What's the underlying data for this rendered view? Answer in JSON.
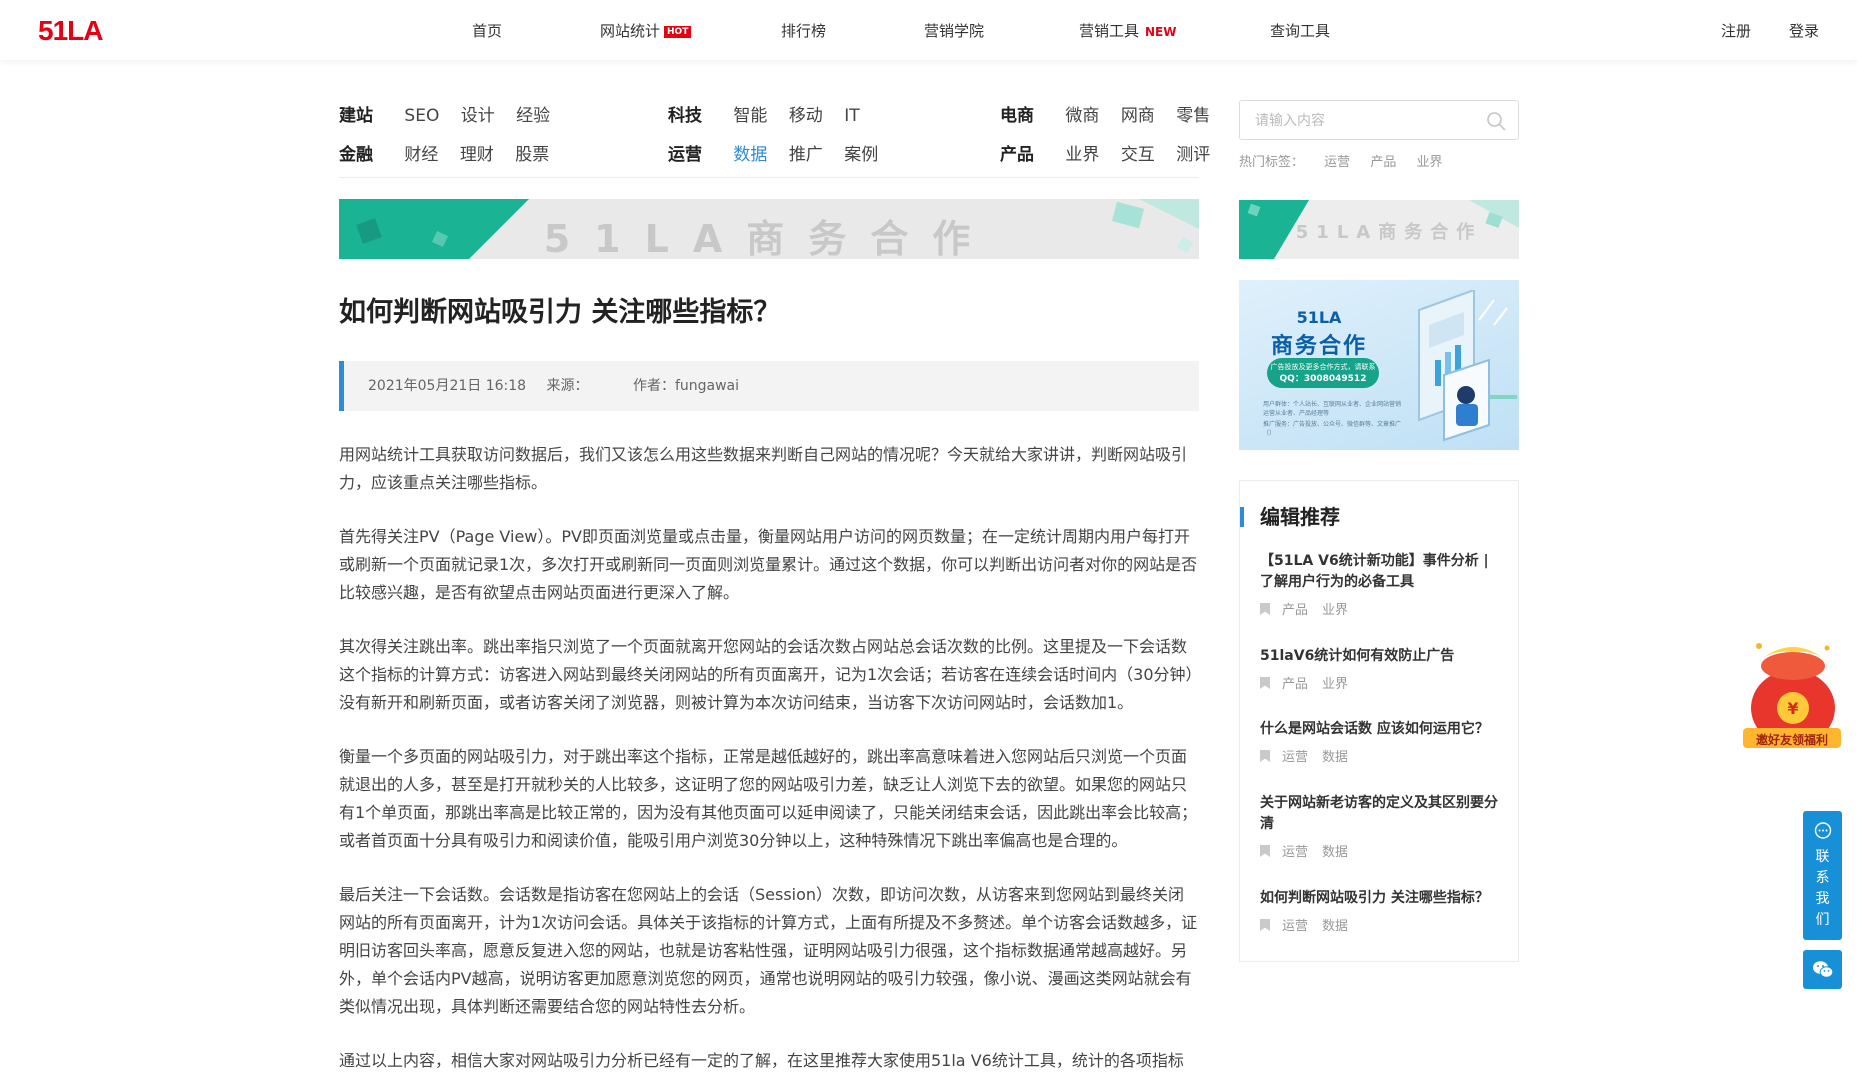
{
  "header": {
    "logo_text": "51LA",
    "nav": [
      {
        "label": "首页"
      },
      {
        "label": "网站统计",
        "badge": "HOT"
      },
      {
        "label": "排行榜"
      },
      {
        "label": "营销学院"
      },
      {
        "label": "营销工具",
        "badge": "NEW"
      },
      {
        "label": "查询工具"
      }
    ],
    "register": "注册",
    "login": "登录"
  },
  "categories": {
    "groups": [
      {
        "head": "建站",
        "items": [
          "SEO",
          "设计",
          "经验"
        ]
      },
      {
        "head": "科技",
        "items": [
          "智能",
          "移动",
          "IT"
        ]
      },
      {
        "head": "电商",
        "items": [
          "微商",
          "网商",
          "零售"
        ]
      },
      {
        "head": "金融",
        "items": [
          "财经",
          "理财",
          "股票"
        ]
      },
      {
        "head": "运营",
        "items": [
          "数据",
          "推广",
          "案例"
        ],
        "active": "数据"
      },
      {
        "head": "产品",
        "items": [
          "业界",
          "交互",
          "测评"
        ]
      }
    ]
  },
  "banner": {
    "main_text": "51LA商务合作",
    "side_text": "51LA商务合作"
  },
  "search": {
    "placeholder": "请输入内容",
    "hot_label": "热门标签：",
    "hot_tags": [
      "运营",
      "产品",
      "业界"
    ]
  },
  "article": {
    "title": "如何判断网站吸引力 关注哪些指标？",
    "date": "2021年05月21日 16:18",
    "source": "来源：",
    "author": "作者：fungawai",
    "paragraphs": [
      "用网站统计工具获取访问数据后，我们又该怎么用这些数据来判断自己网站的情况呢？今天就给大家讲讲，判断网站吸引力，应该重点关注哪些指标。",
      "首先得关注PV（Page View）。PV即页面浏览量或点击量，衡量网站用户访问的网页数量；在一定统计周期内用户每打开或刷新一个页面就记录1次，多次打开或刷新同一页面则浏览量累计。通过这个数据，你可以判断出访问者对你的网站是否比较感兴趣，是否有欲望点击网站页面进行更深入了解。",
      "其次得关注跳出率。跳出率指只浏览了一个页面就离开您网站的会话次数占网站总会话次数的比例。这里提及一下会话数这个指标的计算方式：访客进入网站到最终关闭网站的所有页面离开，记为1次会话；若访客在连续会话时间内（30分钟）没有新开和刷新页面，或者访客关闭了浏览器，则被计算为本次访问结束，当访客下次访问网站时，会话数加1。",
      "衡量一个多页面的网站吸引力，对于跳出率这个指标，正常是越低越好的，跳出率高意味着进入您网站后只浏览一个页面就退出的人多，甚至是打开就秒关的人比较多，这证明了您的网站吸引力差，缺乏让人浏览下去的欲望。如果您的网站只有1个单页面，那跳出率高是比较正常的，因为没有其他页面可以延申阅读了，只能关闭结束会话，因此跳出率会比较高；或者首页面十分具有吸引力和阅读价值，能吸引用户浏览30分钟以上，这种特殊情况下跳出率偏高也是合理的。",
      "最后关注一下会话数。会话数是指访客在您网站上的会话（Session）次数，即访问次数，从访客来到您网站到最终关闭网站的所有页面离开，计为1次访问会话。具体关于该指标的计算方式，上面有所提及不多赘述。单个访客会话数越多，证明旧访客回头率高，愿意反复进入您的网站，也就是访客粘性强，证明网站吸引力很强，这个指标数据通常越高越好。另外，单个会话内PV越高，说明访客更加愿意浏览您的网页，通常也说明网站的吸引力较强，像小说、漫画这类网站就会有类似情况出现，具体判断还需要结合您的网站特性去分析。",
      "通过以上内容，相信大家对网站吸引力分析已经有一定的了解，在这里推荐大家使用51la V6统计工具，统计的各项指标齐"
    ]
  },
  "side_ad": {
    "title_1": "51LA",
    "title_2": "商务合作",
    "qq_line1": "广告投放及更多合作方式，请联系",
    "qq_line2": "QQ：3008049512",
    "line_a": "用户群体：个人站长、互联网从业者、企业网站营销运营从业者、产品经理等",
    "line_b": "推广服务：广告投放、公众号、微信群等、文章推广（）"
  },
  "recommend": {
    "heading": "编辑推荐",
    "items": [
      {
        "title": "【51LA V6统计新功能】事件分析 | 了解用户行为的必备工具",
        "tags": [
          "产品",
          "业界"
        ]
      },
      {
        "title": "51laV6统计如何有效防止广告",
        "tags": [
          "产品",
          "业界"
        ]
      },
      {
        "title": "什么是网站会话数 应该如何运用它？",
        "tags": [
          "运营",
          "数据"
        ]
      },
      {
        "title": "关于网站新老访客的定义及其区别要分清",
        "tags": [
          "运营",
          "数据"
        ]
      },
      {
        "title": "如何判断网站吸引力 关注哪些指标？",
        "tags": [
          "运营",
          "数据"
        ]
      }
    ]
  },
  "floating": {
    "gift_label": "邀好友领福利",
    "contact_label": [
      "联",
      "系",
      "我",
      "们"
    ]
  },
  "colors": {
    "accent": "#2f8ad8",
    "brand_red": "#e60012",
    "contact_blue": "#1890d8"
  }
}
